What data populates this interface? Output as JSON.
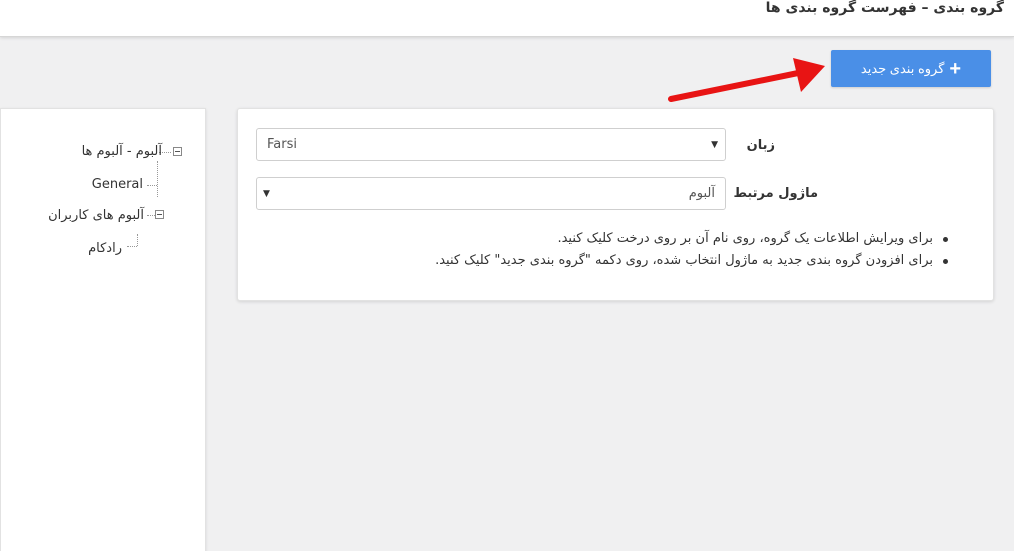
{
  "header": {
    "title": "گروه بندی – فهرست گروه بندی ها"
  },
  "toolbar": {
    "new_button_label": "گروه بندی جدید",
    "new_button_icon": "plus-icon"
  },
  "tree": {
    "nodes": [
      {
        "label": "آلبوم - آلبوم ها",
        "level": 0,
        "has_toggle": true
      },
      {
        "label": "General",
        "level": 1,
        "has_toggle": false
      },
      {
        "label": "آلبوم های کاربران",
        "level": 0,
        "has_toggle": true
      },
      {
        "label": "رادکام",
        "level": 1,
        "has_toggle": false
      }
    ]
  },
  "form": {
    "language_label": "زبان",
    "language_value": "Farsi",
    "module_label": "ماژول مرتبط",
    "module_value": "آلبوم"
  },
  "help": {
    "items": [
      "برای ویرایش اطلاعات یک گروه، روی نام آن بر روی درخت کلیک کنید.",
      "برای افزودن گروه بندی جدید به ماژول انتخاب شده، روی دکمه \"گروه بندی جدید\" کلیک کنید."
    ]
  },
  "colors": {
    "primary_button": "#4a8fe7",
    "annotation_arrow": "#e81414"
  }
}
